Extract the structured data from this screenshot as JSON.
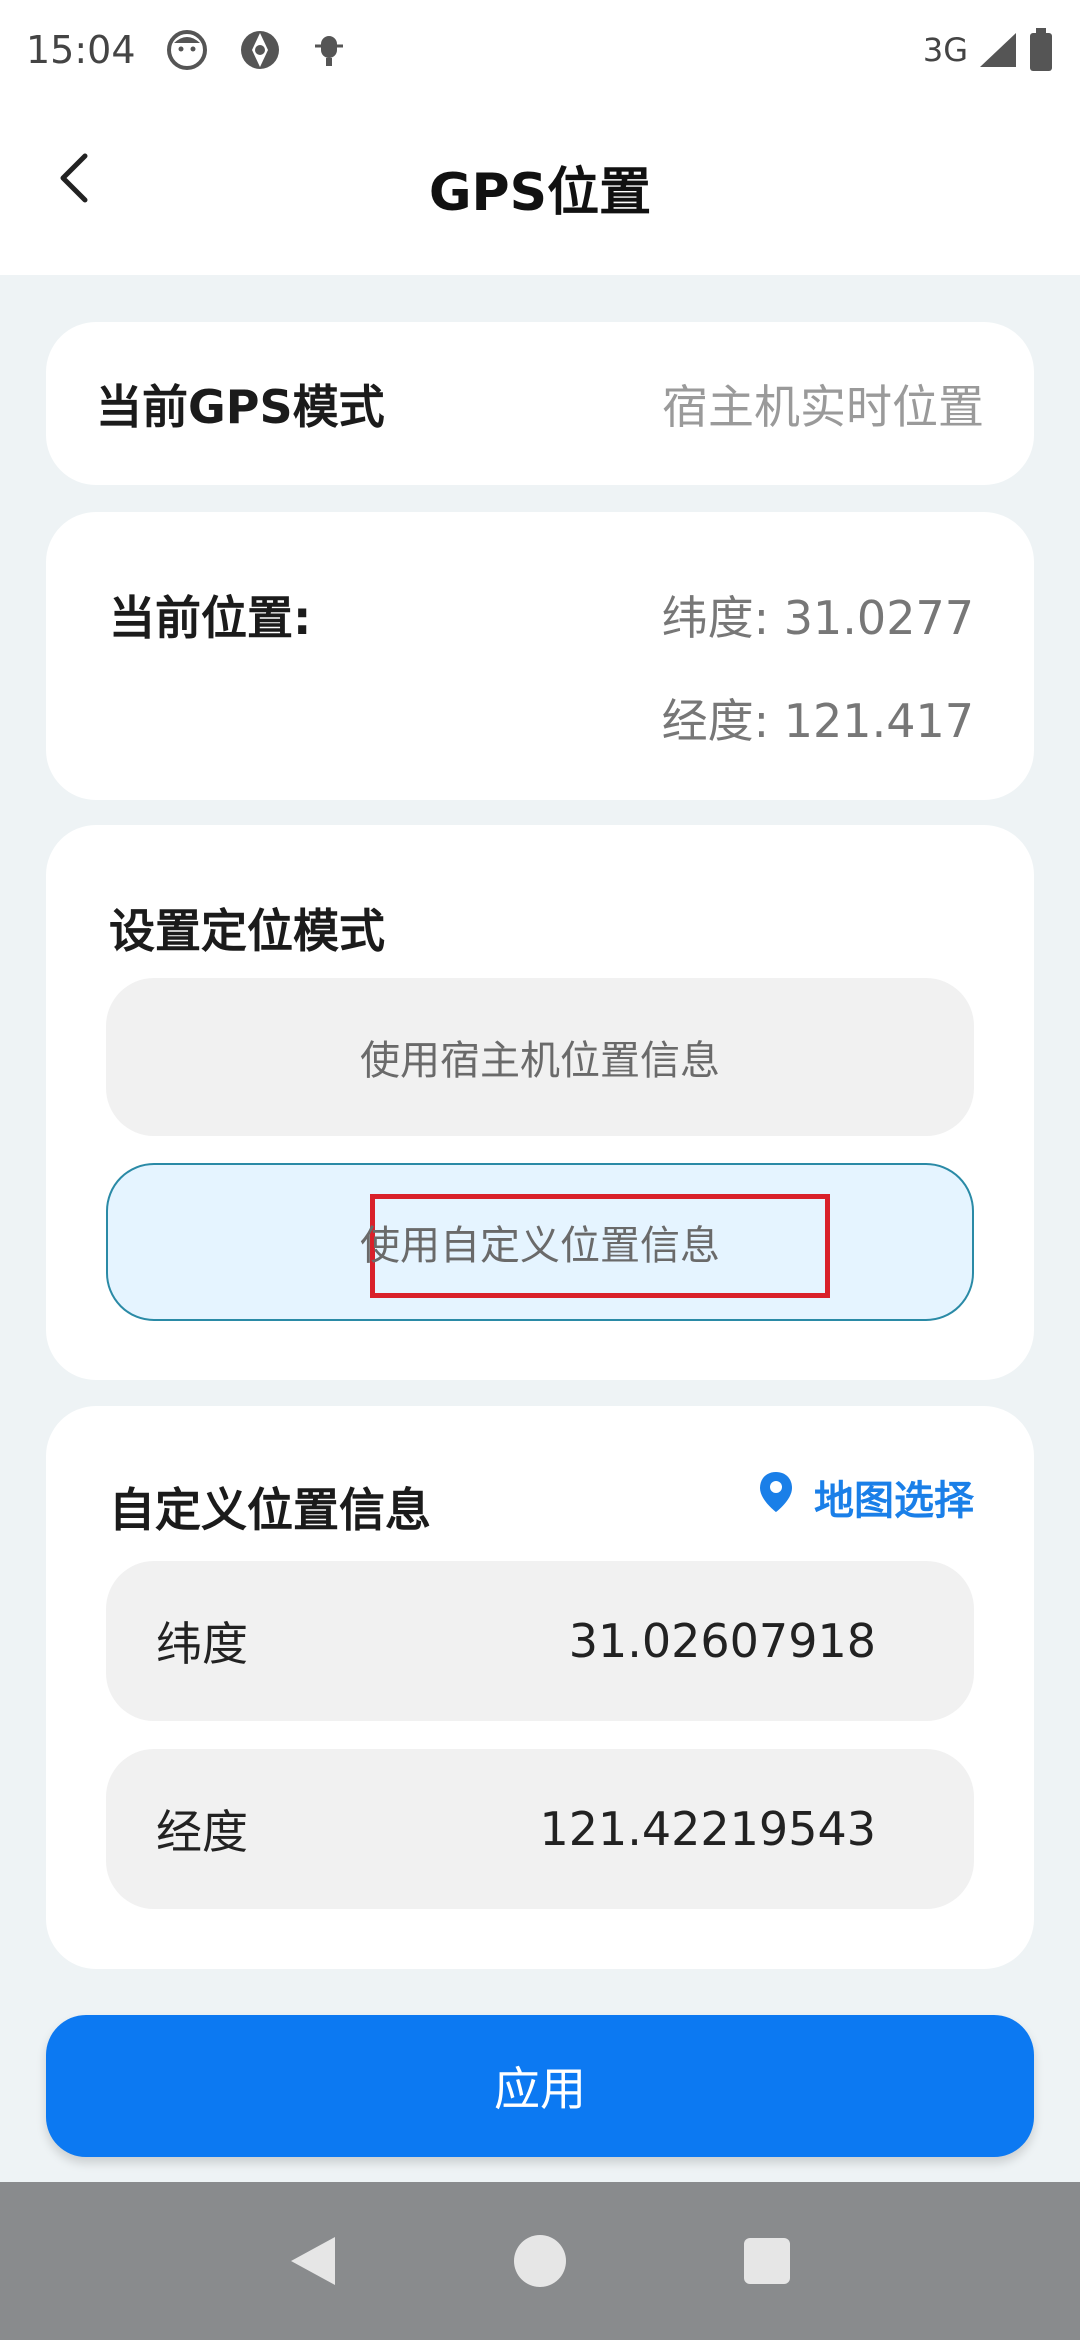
{
  "status_bar": {
    "time": "15:04",
    "network": "3G",
    "icons": [
      "face-icon",
      "aperture-icon",
      "bug-icon"
    ],
    "right_icons": [
      "signal-icon",
      "battery-icon"
    ]
  },
  "app_bar": {
    "title": "GPS位置",
    "back_icon": "chevron-left-icon"
  },
  "gps_mode": {
    "label": "当前GPS模式",
    "value": "宿主机实时位置"
  },
  "current_location": {
    "label": "当前位置:",
    "latitude": "纬度: 31.0277",
    "longitude": "经度: 121.417"
  },
  "set_mode": {
    "title": "设置定位模式",
    "option_host": "使用宿主机位置信息",
    "option_custom": "使用自定义位置信息",
    "selected": "option_custom"
  },
  "custom_location": {
    "title": "自定义位置信息",
    "map_select": "地图选择",
    "map_icon": "location-pin-icon",
    "latitude_label": "纬度",
    "latitude_value": "31.02607918",
    "longitude_label": "经度",
    "longitude_value": "121.42219543"
  },
  "apply_label": "应用",
  "colors": {
    "accent": "#0c79f2",
    "highlight": "#d9202a",
    "selected_bg": "#e5f4ff",
    "selected_border": "#2a8aa6"
  },
  "nav_bar": [
    "back-triangle-icon",
    "home-circle-icon",
    "recents-square-icon"
  ]
}
